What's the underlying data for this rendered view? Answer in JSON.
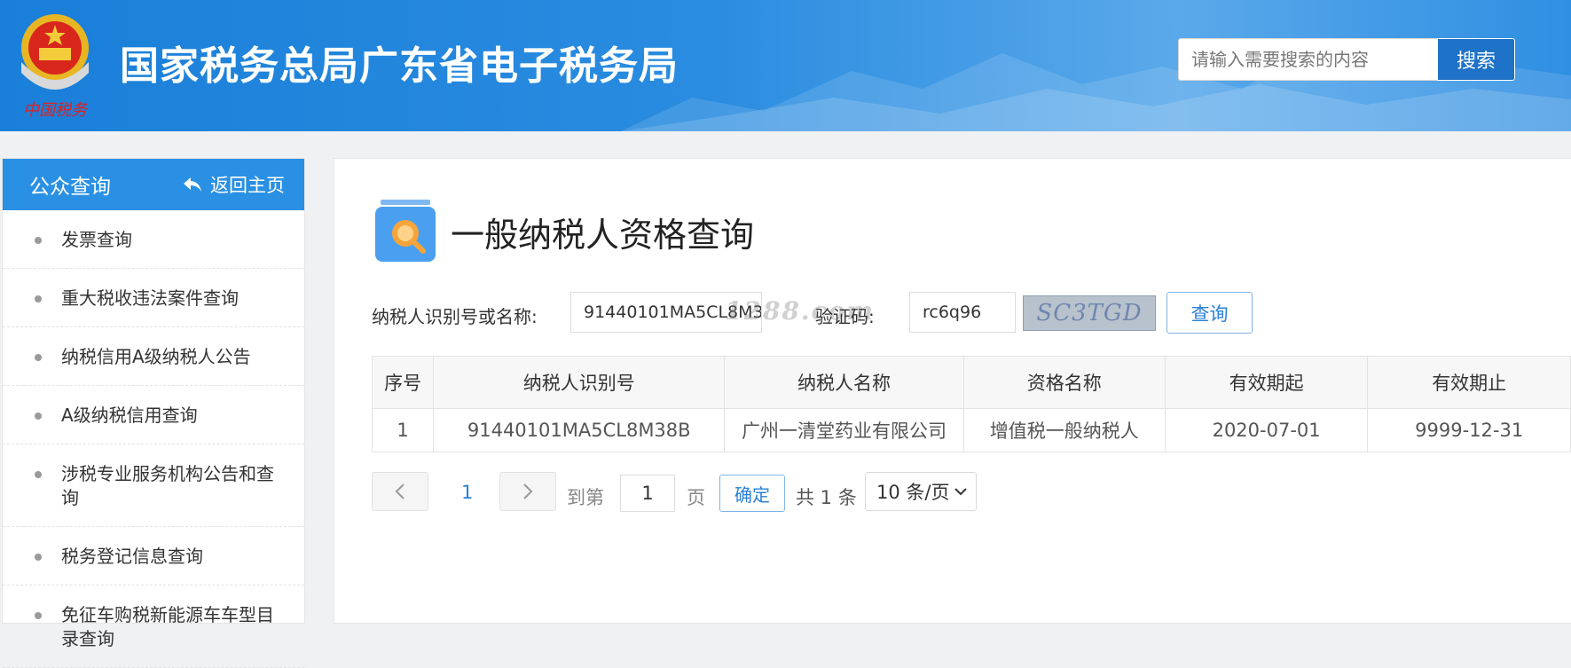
{
  "header": {
    "title": "国家税务总局广东省电子税务局",
    "emblem_text": "中国税务",
    "search_placeholder": "请输入需要搜索的内容",
    "search_button": "搜索"
  },
  "sidebar": {
    "title": "公众查询",
    "back_home": "返回主页",
    "items": [
      {
        "label": "发票查询"
      },
      {
        "label": "重大税收违法案件查询"
      },
      {
        "label": "纳税信用A级纳税人公告"
      },
      {
        "label": "A级纳税信用查询"
      },
      {
        "label": "涉税专业服务机构公告和查询"
      },
      {
        "label": "税务登记信息查询"
      },
      {
        "label": "免征车购税新能源车车型目录查询"
      }
    ]
  },
  "main": {
    "page_title": "一般纳税人资格查询",
    "form": {
      "taxpayer_label": "纳税人识别号或名称:",
      "taxpayer_value": "91440101MA5CL8M38B",
      "captcha_label": "验证码:",
      "captcha_value": "rc6q96",
      "captcha_image_text": "SC3TGD",
      "query_button": "查询"
    },
    "watermark": "1288.com",
    "table": {
      "headers": [
        "序号",
        "纳税人识别号",
        "纳税人名称",
        "资格名称",
        "有效期起",
        "有效期止"
      ],
      "rows": [
        [
          "1",
          "91440101MA5CL8M38B",
          "广州一清堂药业有限公司",
          "增值税一般纳税人",
          "2020-07-01",
          "9999-12-31"
        ]
      ]
    },
    "pager": {
      "current_page": "1",
      "goto_label": "到第",
      "goto_value": "1",
      "page_unit": "页",
      "confirm_button": "确定",
      "total_text": "共 1 条",
      "page_size": "10 条/页"
    }
  },
  "colors": {
    "header_blue": "#1a7fd9",
    "sidebar_head": "#2a90e3",
    "accent": "#2a80d8"
  }
}
